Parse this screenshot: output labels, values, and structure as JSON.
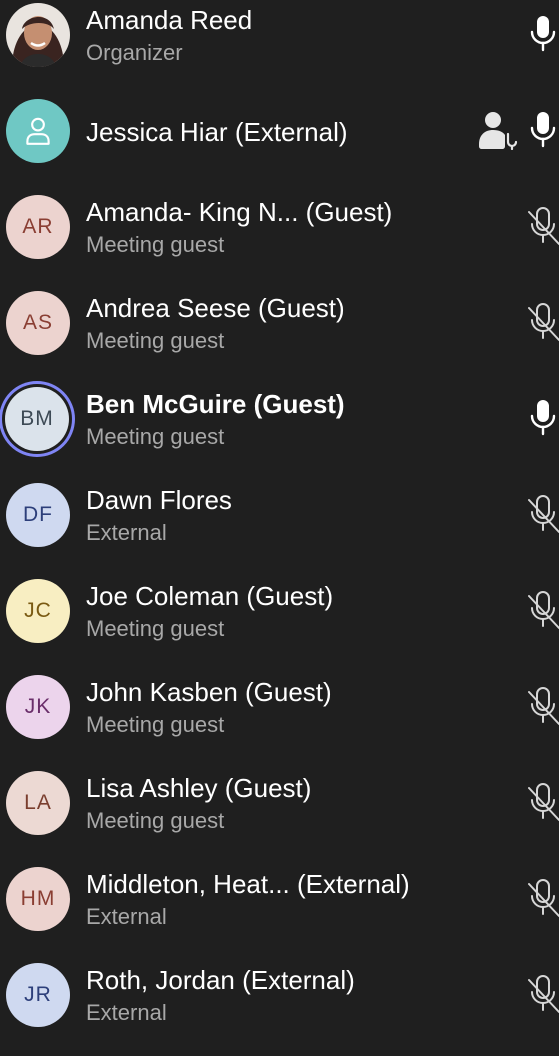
{
  "participants": [
    {
      "name": "Amanda Reed",
      "role": "Organizer",
      "avatar": "photo",
      "mic": "on",
      "mic_icon": "mic-icon"
    },
    {
      "name": "Jessica Hiar (External)",
      "role": "",
      "avatar": "person-icon",
      "avatar_color": "#6fc8c4",
      "mic": "on",
      "extra_icon": "presenter-icon",
      "mic_icon": "mic-icon"
    },
    {
      "name": "Amanda- King N... (Guest)",
      "role": "Meeting guest",
      "initials": "AR",
      "avatar_color": "#ecd3cf",
      "text_color": "#8a3e33",
      "mic": "muted",
      "mic_icon": "mic-muted-icon"
    },
    {
      "name": "Andrea Seese (Guest)",
      "role": "Meeting guest",
      "initials": "AS",
      "avatar_color": "#ecd3cf",
      "text_color": "#8a3e33",
      "mic": "muted",
      "mic_icon": "mic-muted-icon"
    },
    {
      "name": "Ben McGuire (Guest)",
      "role": "Meeting guest",
      "initials": "BM",
      "avatar_color": "#dbe3eb",
      "text_color": "#3d4a55",
      "mic": "on",
      "speaking": true,
      "mic_icon": "mic-icon"
    },
    {
      "name": "Dawn Flores",
      "role": "External",
      "initials": "DF",
      "avatar_color": "#cfd9f0",
      "text_color": "#2d3f7a",
      "mic": "muted",
      "mic_icon": "mic-muted-icon"
    },
    {
      "name": "Joe Coleman (Guest)",
      "role": "Meeting guest",
      "initials": "JC",
      "avatar_color": "#f8eec2",
      "text_color": "#7a5a12",
      "mic": "muted",
      "mic_icon": "mic-muted-icon"
    },
    {
      "name": "John Kasben (Guest)",
      "role": "Meeting guest",
      "initials": "JK",
      "avatar_color": "#ecd4ec",
      "text_color": "#6a2e6a",
      "mic": "muted",
      "mic_icon": "mic-muted-icon"
    },
    {
      "name": "Lisa Ashley (Guest)",
      "role": "Meeting guest",
      "initials": "LA",
      "avatar_color": "#ecd9d3",
      "text_color": "#7a3e2e",
      "mic": "muted",
      "mic_icon": "mic-muted-icon"
    },
    {
      "name": "Middleton, Heat...  (External)",
      "role": "External",
      "initials": "HM",
      "avatar_color": "#ecd3cf",
      "text_color": "#8a3e33",
      "mic": "muted",
      "mic_icon": "mic-muted-icon"
    },
    {
      "name": "Roth, Jordan (External)",
      "role": "External",
      "initials": "JR",
      "avatar_color": "#cfd9f0",
      "text_color": "#2d3f7a",
      "mic": "muted",
      "mic_icon": "mic-muted-icon"
    }
  ]
}
